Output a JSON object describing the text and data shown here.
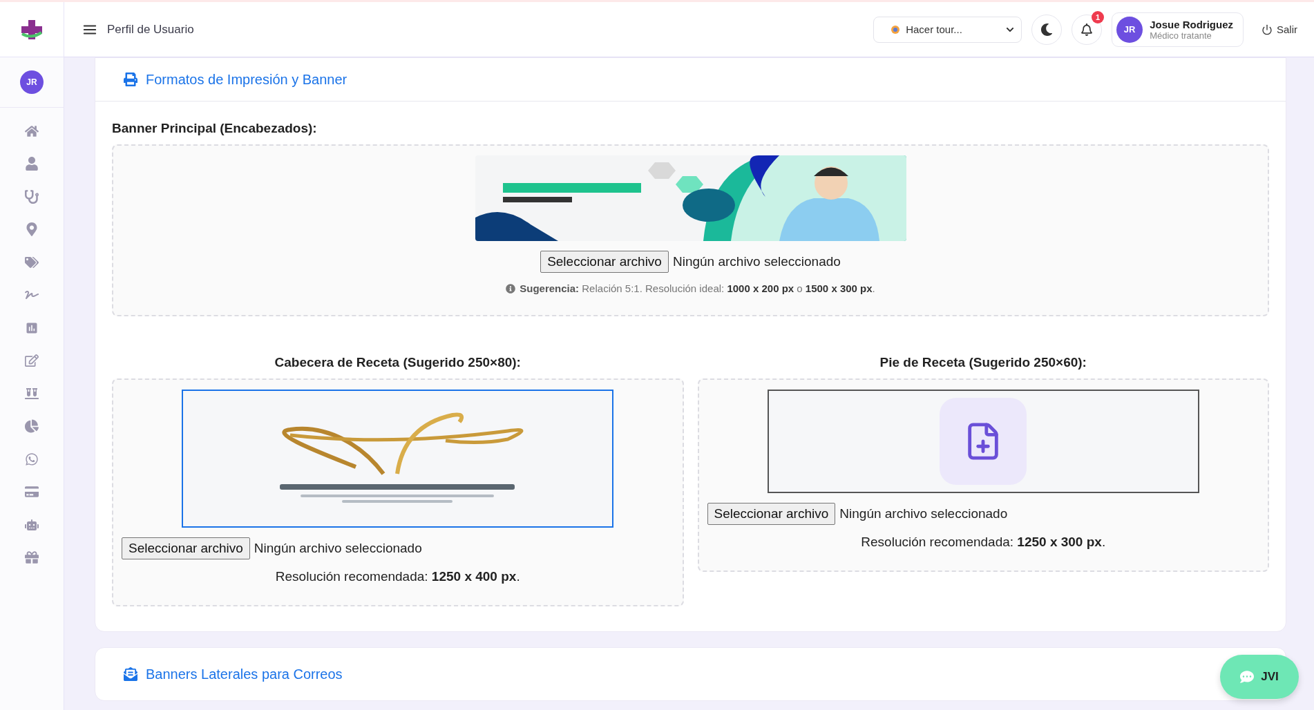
{
  "topbar": {
    "title": "Perfil de Usuario",
    "tour_select": {
      "value": "Hacer tour..."
    },
    "notifications": {
      "count": "1"
    },
    "user": {
      "initials": "JR",
      "name": "Josue Rodriguez",
      "role": "Médico tratante"
    },
    "logout": "Salir"
  },
  "sidebar": {
    "avatar": "JR"
  },
  "print_section": {
    "title": "Formatos de Impresión y Banner",
    "main_banner": {
      "label": "Banner Principal (Encabezados):",
      "file_button": "Seleccionar archivo",
      "file_status": "Ningún archivo seleccionado",
      "hint": "**Sugerencia:** Relación 5:1. Resolución ideal: **1000 x 200 px** o **1500 x 300 px**."
    },
    "uploads": [
      {
        "label": "Cabecera de Receta (Sugerido 250×80):",
        "file_button": "Seleccionar archivo",
        "file_status": "Ningún archivo seleccionado",
        "note": "Resolución recomendada: **1250 x 400 px**."
      },
      {
        "label": "Pie de Receta (Sugerido 250×60):",
        "preview": {
          "kind": "empty"
        },
        "file_button": "Seleccionar archivo",
        "file_status": "Ningún archivo seleccionado",
        "note": "Resolución recomendada: **1250 x 300 px**."
      }
    ]
  },
  "email_section": {
    "title": "Banners Laterales para Correos"
  },
  "chat_button": {
    "label": "JVI"
  }
}
